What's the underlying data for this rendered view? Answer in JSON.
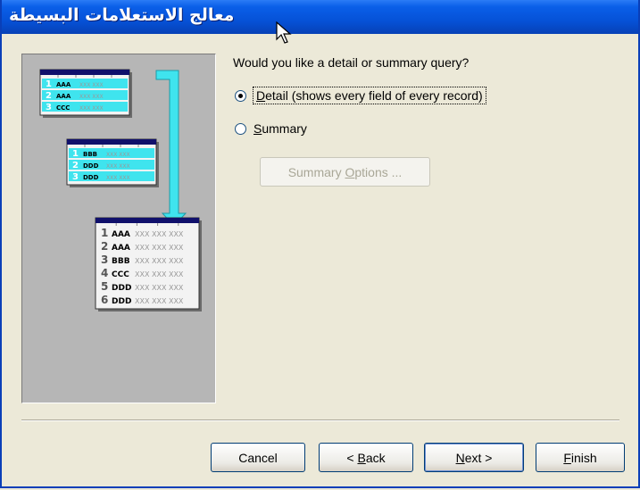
{
  "window": {
    "title": "معالج الاستعلامات البسيطة"
  },
  "question": "Would you like a detail or summary query?",
  "options": [
    {
      "label": "Detail (shows every field of every record)",
      "mnemonic": "D",
      "selected": true
    },
    {
      "label": "Summary",
      "mnemonic": "S",
      "selected": false
    }
  ],
  "summary_options_button": {
    "label": "Summary Options ...",
    "mnemonic": "O",
    "enabled": false
  },
  "buttons": {
    "cancel": "Cancel",
    "back": "< Back",
    "next": "Next >",
    "finish": "Finish"
  },
  "illustration": {
    "table1_rows": [
      {
        "num": "1",
        "key": "AAA",
        "rest": "XXX XXX"
      },
      {
        "num": "2",
        "key": "AAA",
        "rest": "XXX XXX"
      },
      {
        "num": "3",
        "key": "CCC",
        "rest": "XXX XXX"
      }
    ],
    "table2_rows": [
      {
        "num": "1",
        "key": "BBB",
        "rest": "XXX XXX"
      },
      {
        "num": "2",
        "key": "DDD",
        "rest": "XXX XXX"
      },
      {
        "num": "3",
        "key": "DDD",
        "rest": "XXX XXX"
      }
    ],
    "result_rows": [
      {
        "num": "1",
        "key": "AAA",
        "rest": "XXX XXX XXX"
      },
      {
        "num": "2",
        "key": "AAA",
        "rest": "XXX XXX XXX"
      },
      {
        "num": "3",
        "key": "BBB",
        "rest": "XXX XXX XXX"
      },
      {
        "num": "4",
        "key": "CCC",
        "rest": "XXX XXX XXX"
      },
      {
        "num": "5",
        "key": "DDD",
        "rest": "XXX XXX XXX"
      },
      {
        "num": "6",
        "key": "DDD",
        "rest": "XXX XXX XXX"
      }
    ],
    "colors": {
      "arrow": "#3fe4ee",
      "header": "#10106b",
      "panel": "#b6b6b6"
    }
  }
}
